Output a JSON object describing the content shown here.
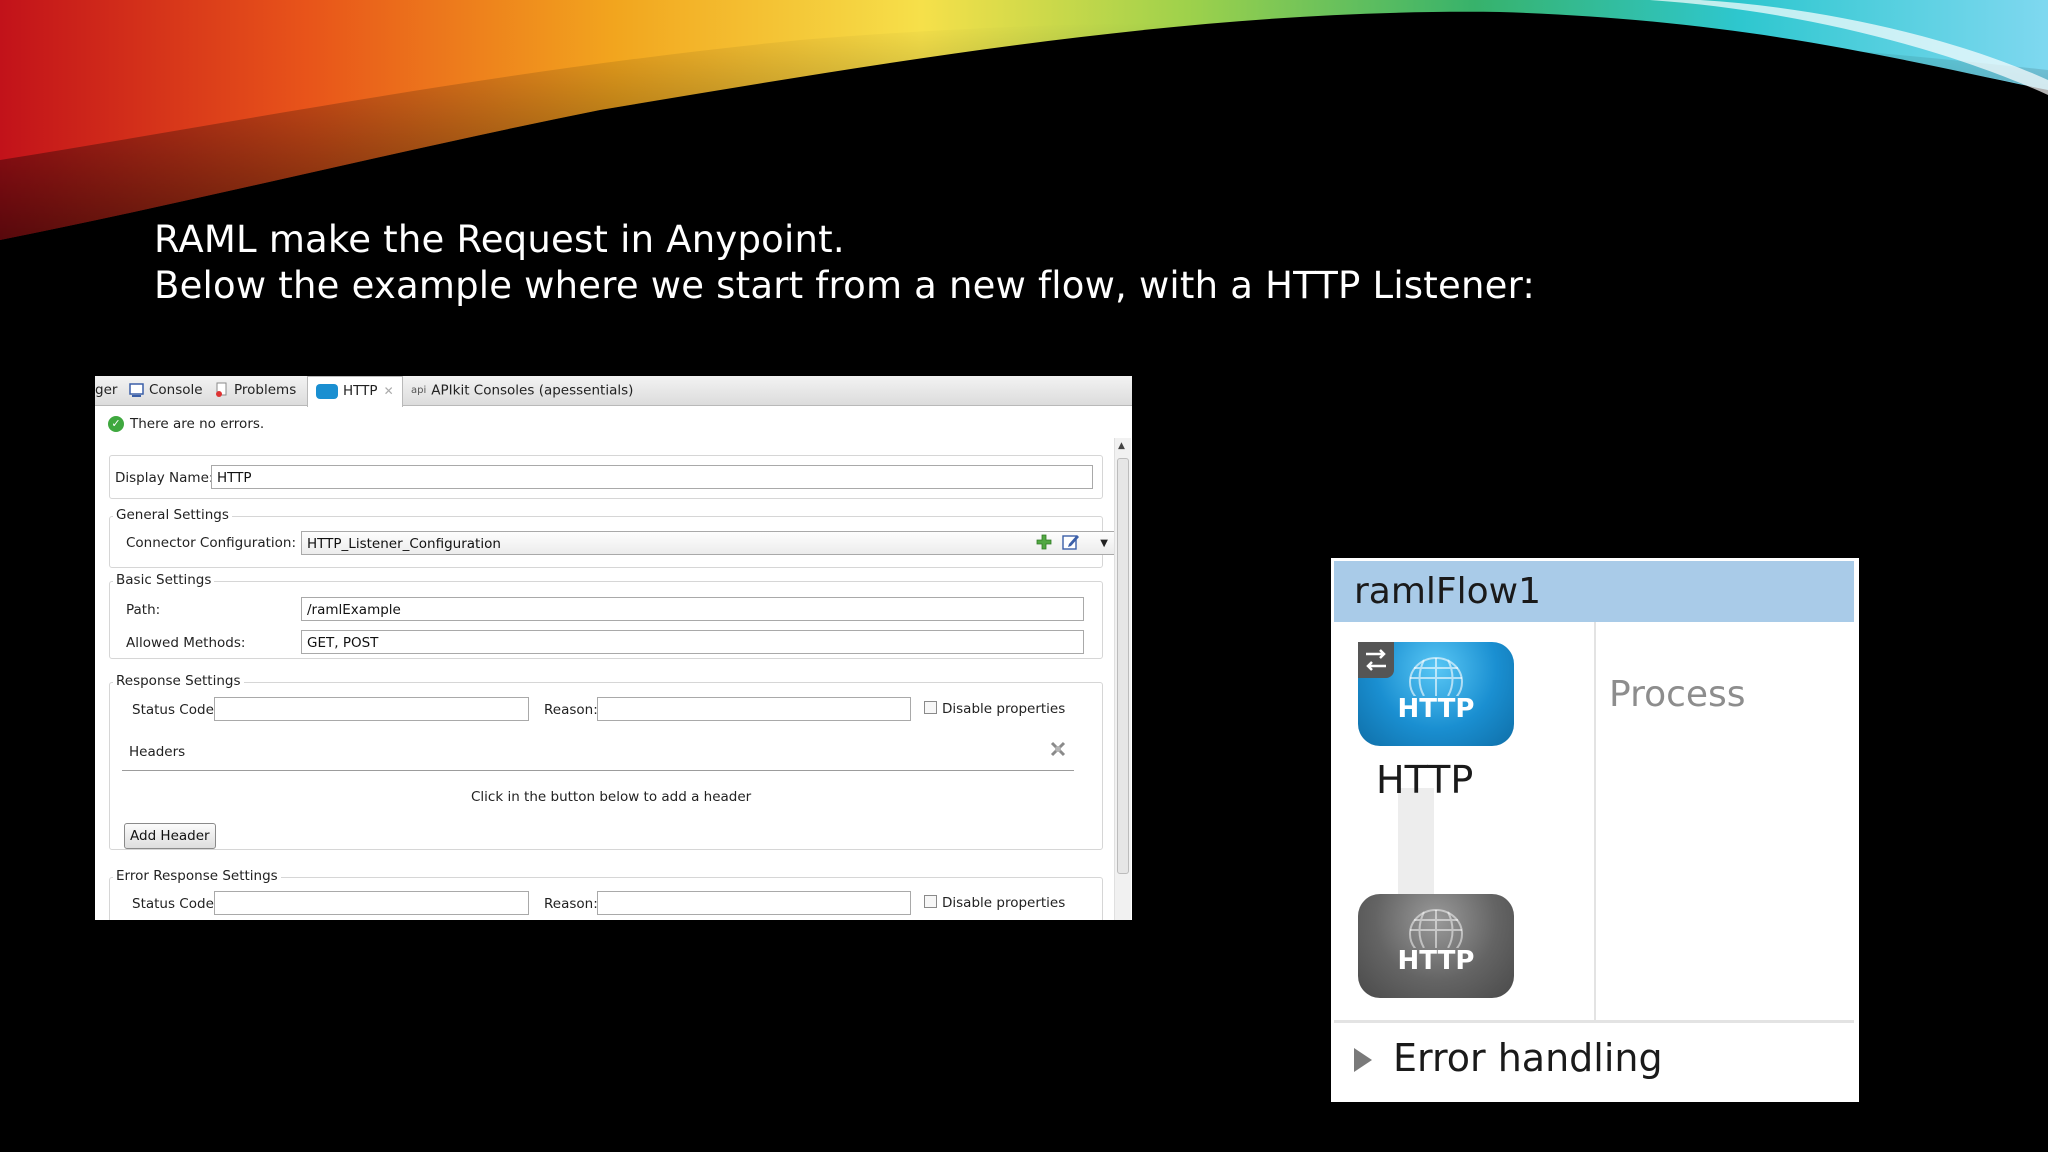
{
  "slide": {
    "line1": "RAML make the Request in Anypoint.",
    "line2": "Below the example where we start from a new flow, with a HTTP Listener:"
  },
  "properties_panel": {
    "tabs": [
      {
        "label": "ger",
        "icon": "none"
      },
      {
        "label": "Console",
        "icon": "console-icon"
      },
      {
        "label": "Problems",
        "icon": "problems-icon"
      },
      {
        "label": "HTTP",
        "icon": "http-globe-icon",
        "active": true
      },
      {
        "label": "APIkit Consoles (apessentials)",
        "icon": "api-icon"
      }
    ],
    "status_message": "There are no errors.",
    "display_name_label": "Display Name:",
    "display_name_value": "HTTP",
    "general_settings": {
      "legend": "General Settings",
      "connector_label": "Connector Configuration:",
      "connector_value": "HTTP_Listener_Configuration"
    },
    "basic_settings": {
      "legend": "Basic Settings",
      "path_label": "Path:",
      "path_value": "/ramlExample",
      "methods_label": "Allowed Methods:",
      "methods_value": "GET, POST"
    },
    "response_settings": {
      "legend": "Response Settings",
      "status_code_label": "Status Code:",
      "reason_label": "Reason:",
      "disable_properties_label": "Disable properties",
      "headers_label": "Headers",
      "headers_hint": "Click in the button below to add a header",
      "add_header_button": "Add Header"
    },
    "error_response_settings": {
      "legend": "Error Response Settings",
      "status_code_label": "Status Code:",
      "reason_label": "Reason:",
      "disable_properties_label": "Disable properties"
    }
  },
  "flow_diagram": {
    "title": "ramlFlow1",
    "source_node_text": "HTTP",
    "source_node_label": "HTTP",
    "outbound_node_text": "HTTP",
    "process_label": "Process",
    "error_handling_label": "Error handling",
    "colors": {
      "header": "#a9cbe8",
      "source_node": "#1a8fd1",
      "outbound_node": "#646464"
    }
  }
}
